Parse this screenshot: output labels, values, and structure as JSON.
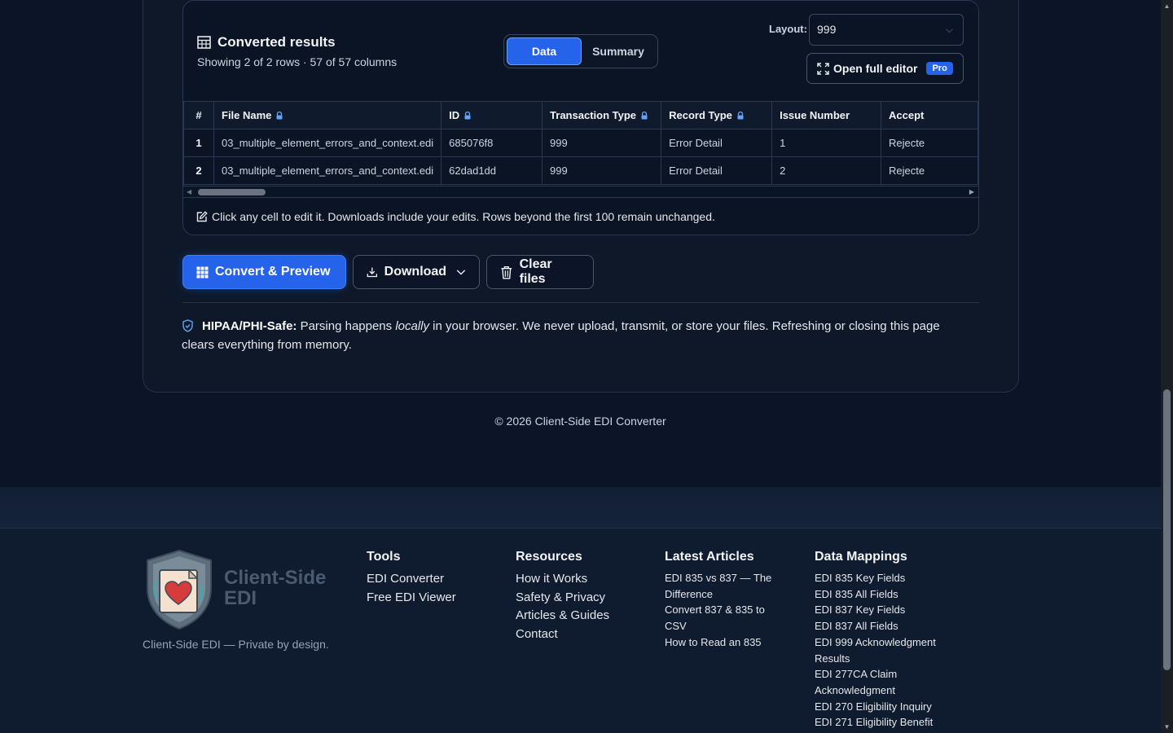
{
  "results": {
    "title": "Converted results",
    "subtitle": "Showing 2 of 2 rows · 57 of 57 columns",
    "view_toggle": {
      "data_label": "Data",
      "summary_label": "Summary",
      "active": "Data"
    },
    "layout_label": "Layout:",
    "layout_value": "999",
    "open_editor_label": "Open full editor",
    "pro_badge": "Pro",
    "table": {
      "columns": [
        "#",
        "File Name",
        "ID",
        "Transaction Type",
        "Record Type",
        "Issue Number",
        "Accept"
      ],
      "locked_columns": [
        "File Name",
        "ID",
        "Transaction Type",
        "Record Type"
      ],
      "rows": [
        [
          "1",
          "03_multiple_element_errors_and_context.edi",
          "685076f8",
          "999",
          "Error Detail",
          "1",
          "Rejecte"
        ],
        [
          "2",
          "03_multiple_element_errors_and_context.edi",
          "62dad1dd",
          "999",
          "Error Detail",
          "2",
          "Rejecte"
        ]
      ]
    },
    "edit_note": "Click any cell to edit it. Downloads include your edits. Rows beyond the first 100 remain unchanged."
  },
  "actions": {
    "convert_label": "Convert & Preview",
    "download_label": "Download",
    "clear_label": "Clear files"
  },
  "hipaa": {
    "title": "HIPAA/PHI-Safe:",
    "text_before": " Parsing happens ",
    "emphasis": "locally",
    "text_after": " in your browser. We never upload, transmit, or store your files. Refreshing or closing this page clears everything from memory."
  },
  "copyright": "© 2026 Client-Side EDI Converter",
  "footer": {
    "logo_line1": "Client-Side",
    "logo_line2": "EDI",
    "tagline": "Client-Side EDI — Private by design.",
    "tools": {
      "heading": "Tools",
      "links": [
        "EDI Converter",
        "Free EDI Viewer"
      ]
    },
    "resources": {
      "heading": "Resources",
      "links": [
        "How it Works",
        "Safety & Privacy",
        "Articles & Guides",
        "Contact"
      ]
    },
    "articles": {
      "heading": "Latest Articles",
      "links": [
        "EDI 835 vs 837 — The Difference",
        "Convert 837 & 835 to CSV",
        "How to Read an 835"
      ]
    },
    "mappings": {
      "heading": "Data Mappings",
      "links": [
        "EDI 835 Key Fields",
        "EDI 835 All Fields",
        "EDI 837 Key Fields",
        "EDI 837 All Fields",
        "EDI 999 Acknowledgment Results",
        "EDI 277CA Claim Acknowledgment",
        "EDI 270 Eligibility Inquiry",
        "EDI 271 Eligibility Benefit"
      ]
    }
  },
  "colors": {
    "accent": "#2563eb",
    "background": "#0c1527",
    "footer_bg": "#0f1b2e"
  }
}
